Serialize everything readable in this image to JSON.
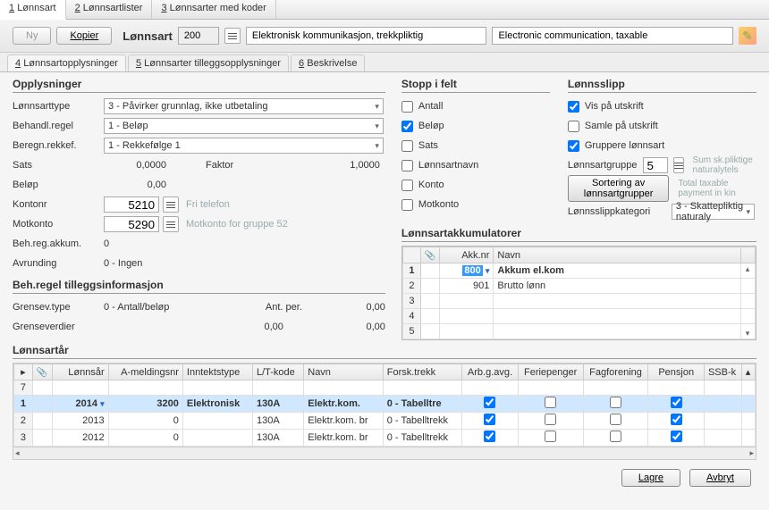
{
  "top_tabs": {
    "t1_num": "1",
    "t1": "Lønnsart",
    "t2_num": "2",
    "t2": "Lønnsartlister",
    "t3_num": "3",
    "t3": "Lønnsarter med koder"
  },
  "toolbar": {
    "ny": "Ny",
    "kopier": "Kopier",
    "label": "Lønnsart",
    "code": "200",
    "name_nb": "Elektronisk kommunikasjon, trekkpliktig",
    "name_en": "Electronic communication, taxable"
  },
  "sub_tabs": {
    "s4_num": "4",
    "s4": "Lønnsartopplysninger",
    "s5_num": "5",
    "s5": "Lønnsarter tilleggsopplysninger",
    "s6_num": "6",
    "s6": "Beskrivelse"
  },
  "opplysninger": {
    "header": "Opplysninger",
    "type_lab": "Lønnsarttype",
    "type_val": "3 - Påvirker grunnlag, ikke utbetaling",
    "behregel_lab": "Behandl.regel",
    "behregel_val": "1 - Beløp",
    "rekkef_lab": "Beregn.rekkef.",
    "rekkef_val": "1 - Rekkefølge 1",
    "sats_lab": "Sats",
    "sats_val": "0,0000",
    "faktor_lab": "Faktor",
    "faktor_val": "1,0000",
    "belop_lab": "Beløp",
    "belop_val": "0,00",
    "kontonr_lab": "Kontonr",
    "kontonr_val": "5210",
    "kontonr_hint": "Fri telefon",
    "motkonto_lab": "Motkonto",
    "motkonto_val": "5290",
    "motkonto_hint": "Motkonto for gruppe 52",
    "behregakk_lab": "Beh.reg.akkum.",
    "behregakk_val": "0",
    "avrunding_lab": "Avrunding",
    "avrunding_val": "0 - Ingen"
  },
  "tillegg": {
    "header": "Beh.regel tilleggsinformasjon",
    "grensev_lab": "Grensev.type",
    "grensev_val": "0 - Antall/beløp",
    "antper_lab": "Ant. per.",
    "antper_val": "0,00",
    "grenseverdier_lab": "Grenseverdier",
    "grenseverdier_val1": "0,00",
    "grenseverdier_val2": "0,00"
  },
  "stopp": {
    "header": "Stopp i felt",
    "antall": "Antall",
    "belop": "Beløp",
    "sats": "Sats",
    "lonnsartnavn": "Lønnsartnavn",
    "konto": "Konto",
    "motkonto": "Motkonto"
  },
  "slipp": {
    "header": "Lønnsslipp",
    "vis": "Vis på utskrift",
    "samle": "Samle på utskrift",
    "gruppere": "Gruppere lønnsart",
    "gruppe_lab": "Lønnsartgruppe",
    "gruppe_val": "5",
    "gruppe_hint": "Sum sk.pliktige naturalytels",
    "sort_btn": "Sortering av lønnsartgrupper",
    "sort_hint": "Total taxable payment in kin",
    "kategori_lab": "Lønnsslippkategori",
    "kategori_val": "3 - Skattepliktig naturaly"
  },
  "akkum": {
    "header": "Lønnsartakkumulatorer",
    "col_akknr": "Akk.nr",
    "col_navn": "Navn",
    "rows": [
      {
        "num": "1",
        "akknr": "800",
        "navn": "Akkum el.kom",
        "bold": true,
        "sel": true
      },
      {
        "num": "2",
        "akknr": "901",
        "navn": "Brutto lønn"
      },
      {
        "num": "3",
        "akknr": "",
        "navn": ""
      },
      {
        "num": "4",
        "akknr": "",
        "navn": ""
      },
      {
        "num": "5",
        "akknr": "",
        "navn": ""
      }
    ]
  },
  "lonnsartar": {
    "header": "Lønnsartår",
    "cols": {
      "lonnsar": "Lønnsår",
      "ameld": "A-meldingsnr",
      "inntekt": "Inntektstype",
      "lt": "L/T-kode",
      "navn": "Navn",
      "forsk": "Forsk.trekk",
      "arb": "Arb.g.avg.",
      "ferie": "Feriepenger",
      "fag": "Fagforening",
      "pensjon": "Pensjon",
      "ssb": "SSB-k"
    },
    "rows": [
      {
        "num": "7"
      },
      {
        "num": "1",
        "year": "2014",
        "am": "3200",
        "it": "Elektronisk",
        "lt": "130A",
        "navn": "Elektr.kom.",
        "forsk": "0 - Tabelltre",
        "arb": true,
        "ferie": false,
        "fag": false,
        "pensjon": true,
        "bold": true,
        "sel": true
      },
      {
        "num": "2",
        "year": "2013",
        "am": "0",
        "it": "",
        "lt": "130A",
        "navn": "Elektr.kom. br",
        "forsk": "0 - Tabelltrekk",
        "arb": true,
        "ferie": false,
        "fag": false,
        "pensjon": true
      },
      {
        "num": "3",
        "year": "2012",
        "am": "0",
        "it": "",
        "lt": "130A",
        "navn": "Elektr.kom. br",
        "forsk": "0 - Tabelltrekk",
        "arb": true,
        "ferie": false,
        "fag": false,
        "pensjon": true
      }
    ]
  },
  "footer": {
    "lagre": "Lagre",
    "avbryt": "Avbryt"
  }
}
